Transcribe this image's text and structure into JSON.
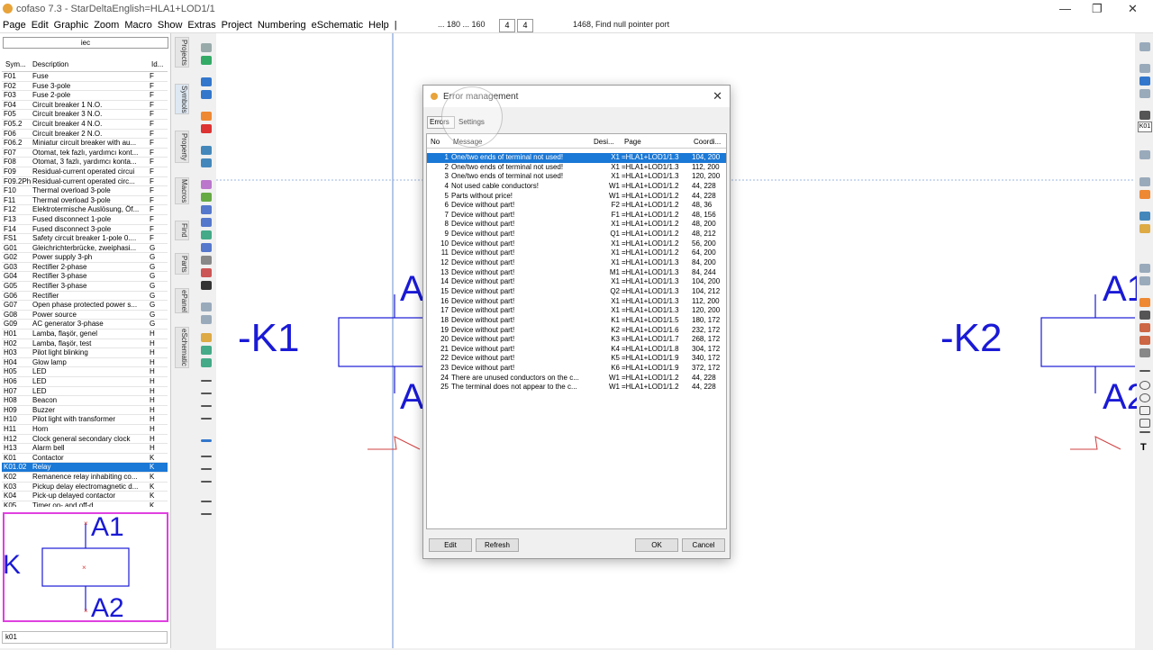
{
  "window": {
    "title": "cofaso 7.3 - StarDeltaEnglish=HLA1+LOD1/1"
  },
  "menu": [
    "Page",
    "Edit",
    "Graphic",
    "Zoom",
    "Macro",
    "Show",
    "Extras",
    "Project",
    "Numbering",
    "eSchematic",
    "Help",
    "|"
  ],
  "status": {
    "coords": "... 180 ... 160",
    "box1": "4",
    "box2": "4",
    "message": "1468, Find null pointer port"
  },
  "library": {
    "field": "iec",
    "search_value": "k01",
    "headers": {
      "sym": "Sym...",
      "desc": "Description",
      "id": "Id..."
    },
    "rows": [
      [
        "F01",
        "Fuse",
        "F"
      ],
      [
        "F02",
        "Fuse 3-pole",
        "F"
      ],
      [
        "F03",
        "Fuse 2-pole",
        "F"
      ],
      [
        "F04",
        "Circuit breaker 1 N.O.",
        "F"
      ],
      [
        "F05",
        "Circuit breaker 3 N.O.",
        "F"
      ],
      [
        "F05.2",
        "Circuit breaker 4 N.O.",
        "F"
      ],
      [
        "F06",
        "Circuit breaker 2 N.O.",
        "F"
      ],
      [
        "F06.2",
        "Miniatur circuit breaker with au...",
        "F"
      ],
      [
        "F07",
        "Otomat, tek fazlı, yardımcı kont...",
        "F"
      ],
      [
        "F08",
        "Otomat, 3 fazlı, yardımcı konta...",
        "F"
      ],
      [
        "F09",
        "Residual-current operated circui",
        "F"
      ],
      [
        "F09.2Ph",
        "Residual-current operated circ...",
        "F"
      ],
      [
        "F10",
        "Thermal overload 3-pole",
        "F"
      ],
      [
        "F11",
        "Thermal overload 3-pole",
        "F"
      ],
      [
        "F12",
        "Elektrotermische Auslösung, Öf...",
        "F"
      ],
      [
        "F13",
        "Fused disconnect 1-pole",
        "F"
      ],
      [
        "F14",
        "Fused disconnect 3-pole",
        "F"
      ],
      [
        "FS1",
        "Safety circuit breaker 1-pole 0....",
        "F"
      ],
      [
        "G01",
        "Gleichrichterbrücke, zweiphasi...",
        "G"
      ],
      [
        "G02",
        "Power supply 3-ph",
        "G"
      ],
      [
        "G03",
        "Rectifier 2-phase",
        "G"
      ],
      [
        "G04",
        "Rectifier 3-phase",
        "G"
      ],
      [
        "G05",
        "Rectifier 3-phase",
        "G"
      ],
      [
        "G06",
        "Rectifier",
        "G"
      ],
      [
        "G07",
        "Open phase protected power s...",
        "G"
      ],
      [
        "G08",
        "Power source",
        "G"
      ],
      [
        "G09",
        "AC generator 3-phase",
        "G"
      ],
      [
        "H01",
        "Lamba, flaşör, genel",
        "H"
      ],
      [
        "H02",
        "Lamba, flaşör, test",
        "H"
      ],
      [
        "H03",
        "Pilot light blinking",
        "H"
      ],
      [
        "H04",
        "Glow lamp",
        "H"
      ],
      [
        "H05",
        "LED",
        "H"
      ],
      [
        "H06",
        "LED",
        "H"
      ],
      [
        "H07",
        "LED",
        "H"
      ],
      [
        "H08",
        "Beacon",
        "H"
      ],
      [
        "H09",
        "Buzzer",
        "H"
      ],
      [
        "H10",
        "Pilot light with transformer",
        "H"
      ],
      [
        "H11",
        "Horn",
        "H"
      ],
      [
        "H12",
        "Clock general secondary clock",
        "H"
      ],
      [
        "H13",
        "Alarm bell",
        "H"
      ],
      [
        "K01",
        "Contactor",
        "K"
      ],
      [
        "K01.02",
        "Relay",
        "K"
      ],
      [
        "K02",
        "Remanence relay inhabiting co...",
        "K"
      ],
      [
        "K03",
        "Pickup delay electromagnetic d...",
        "K"
      ],
      [
        "K04",
        "Pick-up delayed contactor",
        "K"
      ],
      [
        "K05",
        "Timer on- and off-d...",
        "K"
      ]
    ],
    "selected_index": 41,
    "preview": {
      "top": "A1",
      "bottom": "A2",
      "left": "K"
    }
  },
  "side_tabs": [
    "Projects",
    "Symbols",
    "Property",
    "Macros",
    "Find",
    "Parts",
    "ePanel",
    "eSchematic"
  ],
  "canvas": {
    "k1": "-K1",
    "k2": "-K2",
    "a_letter": "A",
    "a1_right": "A1",
    "a2_right": "A2"
  },
  "dialog": {
    "title": "Error management",
    "tabs": [
      "Errors",
      "Settings"
    ],
    "headers": {
      "no": "No",
      "message": "Message",
      "desig": "Desi...",
      "page": "Page",
      "coord": "Coordi..."
    },
    "rows": [
      [
        "1",
        "One/two ends of terminal not used!",
        "X1",
        "=HLA1+LOD1/1.3",
        "104, 200"
      ],
      [
        "2",
        "One/two ends of terminal not used!",
        "X1",
        "=HLA1+LOD1/1.3",
        "112, 200"
      ],
      [
        "3",
        "One/two ends of terminal not used!",
        "X1",
        "=HLA1+LOD1/1.3",
        "120, 200"
      ],
      [
        "4",
        "Not used cable conductors!",
        "W1",
        "=HLA1+LOD1/1.2",
        "44, 228"
      ],
      [
        "5",
        "Parts without price!",
        "W1",
        "=HLA1+LOD1/1.2",
        "44, 228"
      ],
      [
        "6",
        "Device without part!",
        "F2",
        "=HLA1+LOD1/1.2",
        "48, 36"
      ],
      [
        "7",
        "Device without part!",
        "F1",
        "=HLA1+LOD1/1.2",
        "48, 156"
      ],
      [
        "8",
        "Device without part!",
        "X1",
        "=HLA1+LOD1/1.2",
        "48, 200"
      ],
      [
        "9",
        "Device without part!",
        "Q1",
        "=HLA1+LOD1/1.2",
        "48, 212"
      ],
      [
        "10",
        "Device without part!",
        "X1",
        "=HLA1+LOD1/1.2",
        "56, 200"
      ],
      [
        "11",
        "Device without part!",
        "X1",
        "=HLA1+LOD1/1.2",
        "64, 200"
      ],
      [
        "12",
        "Device without part!",
        "X1",
        "=HLA1+LOD1/1.3",
        "84, 200"
      ],
      [
        "13",
        "Device without part!",
        "M1",
        "=HLA1+LOD1/1.3",
        "84, 244"
      ],
      [
        "14",
        "Device without part!",
        "X1",
        "=HLA1+LOD1/1.3",
        "104, 200"
      ],
      [
        "15",
        "Device without part!",
        "Q2",
        "=HLA1+LOD1/1.3",
        "104, 212"
      ],
      [
        "16",
        "Device without part!",
        "X1",
        "=HLA1+LOD1/1.3",
        "112, 200"
      ],
      [
        "17",
        "Device without part!",
        "X1",
        "=HLA1+LOD1/1.3",
        "120, 200"
      ],
      [
        "18",
        "Device without part!",
        "K1",
        "=HLA1+LOD1/1.5",
        "180, 172"
      ],
      [
        "19",
        "Device without part!",
        "K2",
        "=HLA1+LOD1/1.6",
        "232, 172"
      ],
      [
        "20",
        "Device without part!",
        "K3",
        "=HLA1+LOD1/1.7",
        "268, 172"
      ],
      [
        "21",
        "Device without part!",
        "K4",
        "=HLA1+LOD1/1.8",
        "304, 172"
      ],
      [
        "22",
        "Device without part!",
        "K5",
        "=HLA1+LOD1/1.9",
        "340, 172"
      ],
      [
        "23",
        "Device without part!",
        "K6",
        "=HLA1+LOD1/1.9",
        "372, 172"
      ],
      [
        "24",
        "There are unused conductors on the c...",
        "W1",
        "=HLA1+LOD1/1.2",
        "44, 228"
      ],
      [
        "25",
        "The terminal does not appear to the c...",
        "W1",
        "=HLA1+LOD1/1.2",
        "44, 228"
      ]
    ],
    "selected_index": 0,
    "buttons": {
      "edit": "Edit",
      "refresh": "Refresh",
      "ok": "OK",
      "cancel": "Cancel"
    }
  },
  "right_toolbar": {
    "label": "K01"
  },
  "colors": {
    "selection": "#1a78d6",
    "schematic": "#1a1ad6",
    "preview_border": "#e040e0"
  }
}
